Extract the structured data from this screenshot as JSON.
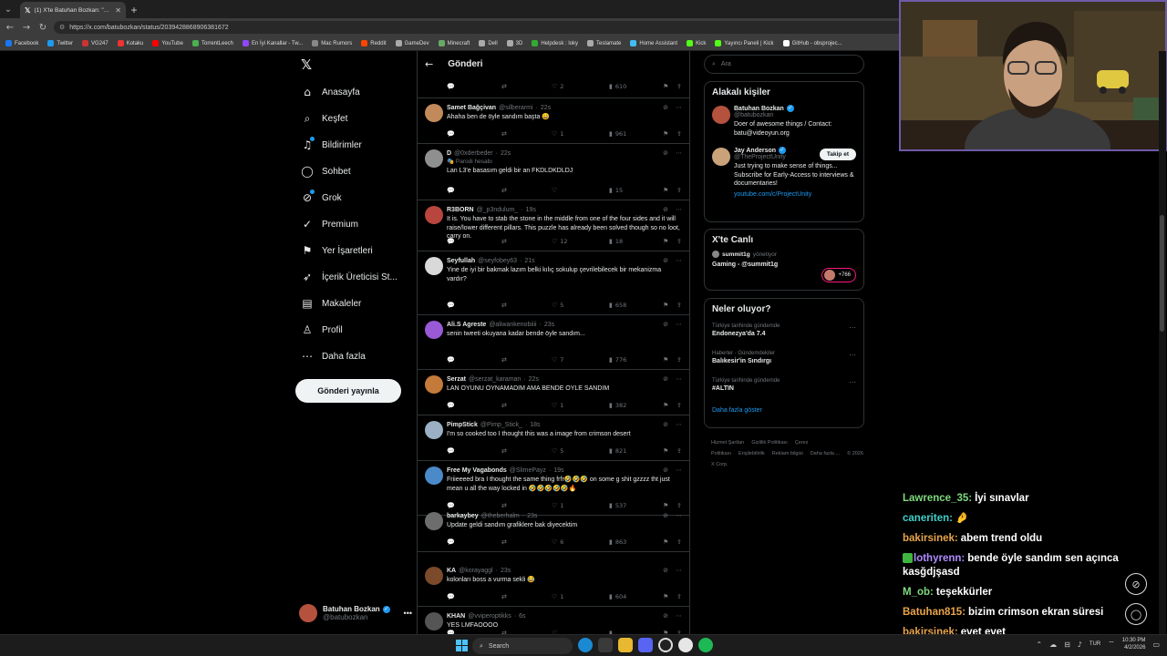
{
  "browser": {
    "tab_title": "(1) X'te Batuhan Bozkan: \"Crimson",
    "url": "https://x.com/batubozkan/status/2039428868906381672",
    "bookmarks": [
      "Facebook",
      "Twitter",
      "VG247",
      "Kotaku",
      "YouTube",
      "TorrentLeech",
      "En İyi Kanallar - Tw...",
      "Mac Rumors",
      "Reddit",
      "GameDev",
      "Minecraft",
      "Dell",
      "3D",
      "Helpdesk : loky",
      "Teslamate",
      "Home Assistant",
      "Kick",
      "Yayıncı Paneli | Kick",
      "GitHub - obsprojec..."
    ]
  },
  "leftnav": {
    "items": [
      {
        "label": "Anasayfa",
        "icon": "home-icon"
      },
      {
        "label": "Keşfet",
        "icon": "search-icon"
      },
      {
        "label": "Bildirimler",
        "icon": "bell-icon"
      },
      {
        "label": "Sohbet",
        "icon": "chat-icon"
      },
      {
        "label": "Grok",
        "icon": "grok-icon"
      },
      {
        "label": "Premium",
        "icon": "premium-icon"
      },
      {
        "label": "Yer İşaretleri",
        "icon": "bookmark-icon"
      },
      {
        "label": "İçerik Üreticisi St...",
        "icon": "rocket-icon"
      },
      {
        "label": "Makaleler",
        "icon": "articles-icon"
      },
      {
        "label": "Profil",
        "icon": "profile-icon"
      },
      {
        "label": "Daha fazla",
        "icon": "more-icon"
      }
    ],
    "post_button": "Gönderi yayınla",
    "account": {
      "name": "Batuhan Bozkan",
      "handle": "@batubozkan"
    }
  },
  "feed": {
    "title": "Gönderi",
    "top_stats": {
      "likes": "2",
      "views": "610"
    },
    "replies": [
      {
        "name": "Samet Bağçivan",
        "handle": "@silberarmi",
        "time": "22s",
        "text": "Ahaha ben de öyle sandım başta 😄",
        "likes": "1",
        "views": "961",
        "avatar": "#c28a5a"
      },
      {
        "name": "D",
        "handle": "@0xderbeder",
        "time": "22s",
        "parody": "🎭 Parodi hesabı",
        "text": "Lan L3'e basasım geldi bir an FKDLDKDLDJ",
        "likes": "",
        "views": "15",
        "avatar": "#8f8f8f"
      },
      {
        "name": "R3BORN",
        "handle": "@_p3ndulum_",
        "time": "19s",
        "text": "It is. You have to stab the stone in the middle from one of the four sides and it will raise/lower different pillars. This puzzle has already been solved though so no loot, carry on.",
        "likes": "12",
        "views": "18",
        "avatar": "#b8463e"
      },
      {
        "name": "Seyfullah",
        "handle": "@seyfobey63",
        "time": "21s",
        "text": "Yine de iyi bir bakmak lazım belki kılıç sokulup çevrilebilecek bir mekanizma vardır?",
        "likes": "5",
        "views": "658",
        "avatar": "#d9d9d9"
      },
      {
        "name": "Ali.S Agreste",
        "handle": "@aliwankenobiiii",
        "time": "23s",
        "text": "senin tweeti okuyana kadar bende öyle sandım...",
        "likes": "7",
        "views": "776",
        "avatar": "#9a5ad6"
      },
      {
        "name": "Serzat",
        "handle": "@serzat_karaman",
        "time": "22s",
        "text": "LAN OYUNU OYNAMADIM AMA BENDE OYLE SANDIM",
        "likes": "1",
        "views": "382",
        "avatar": "#c47a3a"
      },
      {
        "name": "PimpStick",
        "handle": "@Pimp_Stick_",
        "time": "18s",
        "text": "I'm so cooked too I thought this was a image from crimson desert",
        "likes": "5",
        "views": "821",
        "avatar": "#9bb0c4"
      },
      {
        "name": "Free My Vagabonds",
        "handle": "@SlimePayz",
        "time": "19s",
        "text": "Friieeeed bra I thought the same thing frfr🤣🤣🤣 on some g shit gzzzz tht just mean u all the way locked in 🤣🤣🤣🤣🤣🔥",
        "likes": "1",
        "views": "537",
        "avatar": "#4a8ac9"
      },
      {
        "name": "barkaybey",
        "handle": "@theberhalm",
        "time": "23s",
        "text": "Update geldi sandım grafiklere bak diyecektim",
        "likes": "6",
        "views": "863",
        "avatar": "#6d6d6d"
      },
      {
        "name": "KA",
        "handle": "@korayaggl",
        "time": "23s",
        "text": "kolonları boss a vurma sekli 😂",
        "likes": "1",
        "views": "604",
        "avatar": "#7a4a2a"
      },
      {
        "name": "KHAN",
        "handle": "@vviperoptikks",
        "time": "6s",
        "text": "YES LMFAOOOO",
        "likes": "",
        "views": "",
        "avatar": "#555"
      }
    ]
  },
  "right": {
    "search_placeholder": "Ara",
    "related_title": "Alakalı kişiler",
    "people": [
      {
        "name": "Batuhan Bozkan",
        "handle": "@batubozkan",
        "bio": "Doer of awesome things / Contact: batu@videoyun.org",
        "link": ""
      },
      {
        "name": "Jay Anderson",
        "handle": "@TheProjectUnity",
        "bio": "Just trying to make sense of things... Subscribe for Early-Access to interviews & documentaries!",
        "link": "youtube.com/c/ProjectUnity",
        "follow": "Takip et"
      }
    ],
    "live": {
      "title": "X'te Canlı",
      "host": "summit1g",
      "host_suffix": "yönetiyor",
      "stream": "Gaming - @summit1g",
      "count": "+766"
    },
    "trends_title": "Neler oluyor?",
    "trends": [
      {
        "context": "Türkiye tarihinde gündemde",
        "name": "Endonezya'da 7.4"
      },
      {
        "context": "Haberler · Gündemdekiler",
        "name": "Balıkesir'in Sındırgı"
      },
      {
        "context": "Türkiye tarihinde gündemde",
        "name": "#ALTIN"
      }
    ],
    "show_more": "Daha fazla göster",
    "footer": [
      "Hizmet Şartları",
      "Gizlilik Politikası",
      "Çerez Politikası",
      "Erişilebilirlik",
      "Reklam bilgisi",
      "Daha fazla ...",
      "© 2026 X Corp."
    ]
  },
  "chat": [
    {
      "user": "Lawrence_35",
      "color": "#7fd97f",
      "msg": "İyi sınavlar"
    },
    {
      "user": "caneriten",
      "color": "#3fd0c9",
      "msg": "🤌"
    },
    {
      "user": "bakirsinek",
      "color": "#e8a54a",
      "msg": "abem trend oldu"
    },
    {
      "user": "lothyrenn",
      "color": "#b08cff",
      "msg": "bende öyle sandım sen açınca kasğdjşasd",
      "badge": true
    },
    {
      "user": "M_ob",
      "color": "#7fd97f",
      "msg": "teşekkürler"
    },
    {
      "user": "Batuhan815",
      "color": "#e8a54a",
      "msg": "bizim crimson ekran süresi"
    },
    {
      "user": "bakirsinek",
      "color": "#e8a54a",
      "msg": "evet evet"
    }
  ],
  "taskbar": {
    "search": "Search",
    "time": "10:30 PM",
    "date": "4/2/2026",
    "lang": "TUR"
  }
}
